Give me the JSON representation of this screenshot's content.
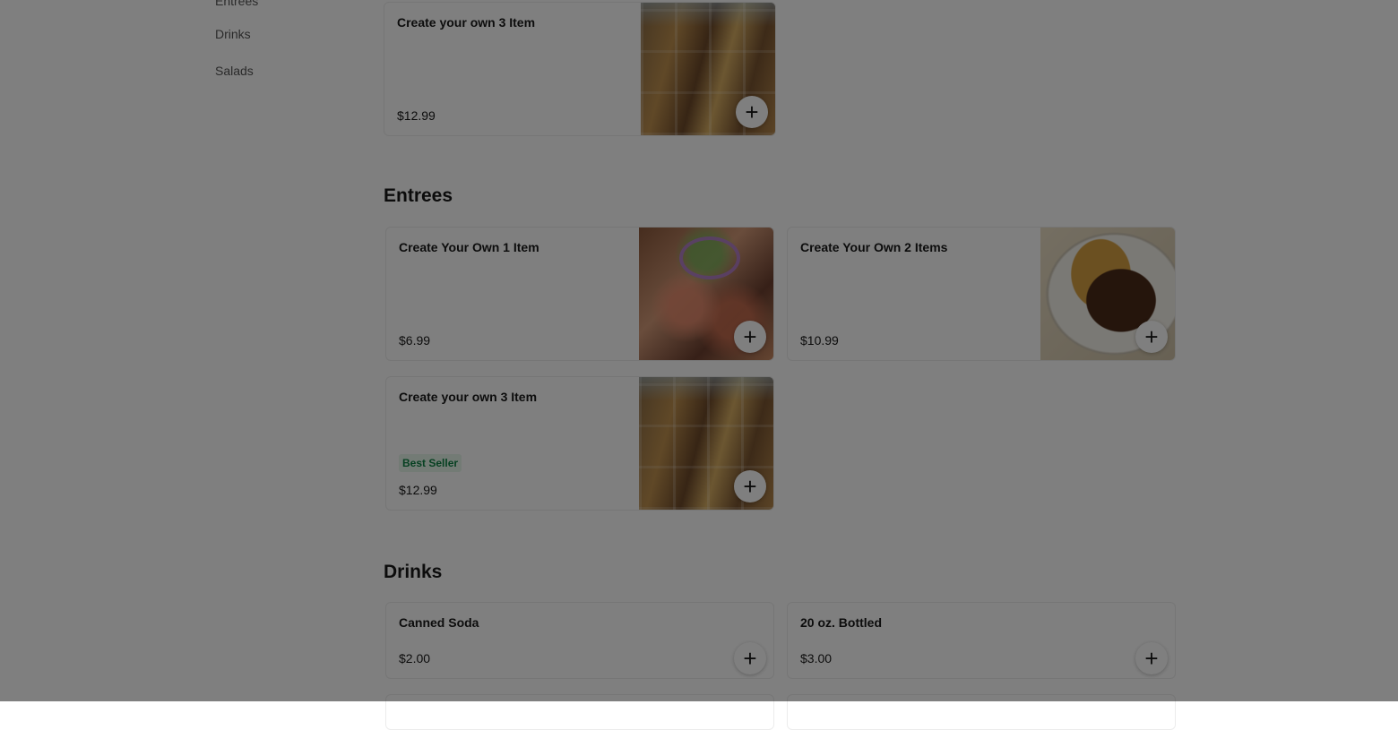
{
  "sidebar": {
    "items": [
      {
        "label": "Entrees"
      },
      {
        "label": "Drinks"
      },
      {
        "label": "Salads"
      }
    ]
  },
  "sections": [
    {
      "title": "",
      "items": [
        {
          "name": "Create your own 3 Item",
          "price": "$12.99",
          "image": "buffet-photo",
          "add_icon": "+"
        }
      ]
    },
    {
      "title": "Entrees",
      "items": [
        {
          "name": "Create Your Own 1 Item",
          "price": "$6.99",
          "image": "seafood-photo",
          "add_icon": "+"
        },
        {
          "name": "Create Your Own 2 Items",
          "price": "$10.99",
          "image": "plate-photo",
          "add_icon": "+"
        },
        {
          "name": "Create your own 3 Item",
          "price": "$12.99",
          "badge": "Best Seller",
          "image": "buffet-photo",
          "add_icon": "+"
        }
      ]
    },
    {
      "title": "Drinks",
      "items": [
        {
          "name": "Canned Soda",
          "price": "$2.00",
          "add_icon": "+"
        },
        {
          "name": "20 oz. Bottled",
          "price": "$3.00",
          "add_icon": "+"
        }
      ]
    }
  ],
  "colors": {
    "modal_overlay": "#000000",
    "badge_text": "#0e8345",
    "badge_bg": "#e6f6ea"
  }
}
